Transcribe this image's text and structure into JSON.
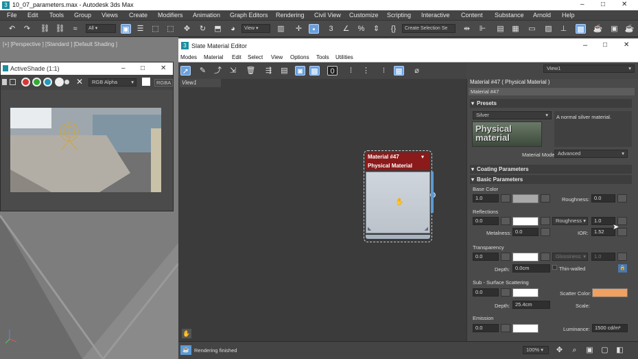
{
  "app": {
    "title": "10_07_parameters.max - Autodesk 3ds Max",
    "minimize_icon": "–",
    "maximize_icon": "□",
    "close_icon": "✕"
  },
  "menubar": [
    "File",
    "Edit",
    "Tools",
    "Group",
    "Views",
    "Create",
    "Modifiers",
    "Animation",
    "Graph Editors",
    "Rendering",
    "Civil View",
    "Customize",
    "Scripting",
    "Interactive",
    "Content",
    "Substance",
    "Arnold",
    "Help"
  ],
  "toolbar": {
    "selection_filter": "All",
    "ref_coord": "View",
    "selection_set": "Create Selection Se"
  },
  "viewport": {
    "label": "[+] [Perspective ] [Standard ] [Default Shading ]"
  },
  "activeshade": {
    "title": "ActiveShade (1:1)",
    "channel": "RGB Alpha",
    "rgba_label": "RGBA"
  },
  "sme": {
    "title": "Slate Material Editor",
    "menu": [
      "Modes",
      "Material",
      "Edit",
      "Select",
      "View",
      "Options",
      "Tools",
      "Utilities"
    ],
    "view_dropdown": "View1",
    "view_tab": "View1",
    "node": {
      "name": "Material #47",
      "type": "Physical Material"
    },
    "status": "Rendering finished",
    "zoom": "100%"
  },
  "panel": {
    "header": "Material #47  ( Physical Material )",
    "name_field": "Material #47",
    "presets": {
      "title": "Presets",
      "preset": "Silver",
      "description": "A normal silver material.",
      "thumb_text": "Physical material",
      "mode_label": "Material Mode:",
      "mode": "Advanced"
    },
    "coating": "Coating Parameters",
    "basic": "Basic Parameters",
    "base_color": {
      "label": "Base Color",
      "weight": "1.0",
      "roughness_label": "Roughness:",
      "roughness": "0.0",
      "swatch": "#a9a9a9"
    },
    "reflections": {
      "label": "Reflections",
      "weight": "0.0",
      "mode": "Roughness",
      "roughness": "1.0",
      "metalness_label": "Metalness:",
      "metalness": "0.0",
      "ior_label": "IOR:",
      "ior": "1.52",
      "swatch": "#ffffff"
    },
    "transparency": {
      "label": "Transparency",
      "weight": "0.0",
      "mode": "Glossiness",
      "value": "1.0",
      "depth_label": "Depth:",
      "depth": "0.0cm",
      "thin_walled": "Thin-walled",
      "swatch": "#ffffff"
    },
    "sss": {
      "label": "Sub - Surface Scattering",
      "weight": "0.0",
      "scatter_label": "Scatter Color:",
      "depth_label": "Depth:",
      "depth": "25.4cm",
      "scale_label": "Scale:",
      "swatch": "#ffffff",
      "scatter_swatch": "#f0a060"
    },
    "emission": {
      "label": "Emission",
      "weight": "0.0",
      "luminance_label": "Luminance:",
      "luminance": "1500 cd/m²",
      "swatch": "#ffffff"
    }
  },
  "colors": {
    "accent": "#5b9bd5",
    "node_header": "#8b1a1a",
    "node_type": "#2f5f8a"
  }
}
